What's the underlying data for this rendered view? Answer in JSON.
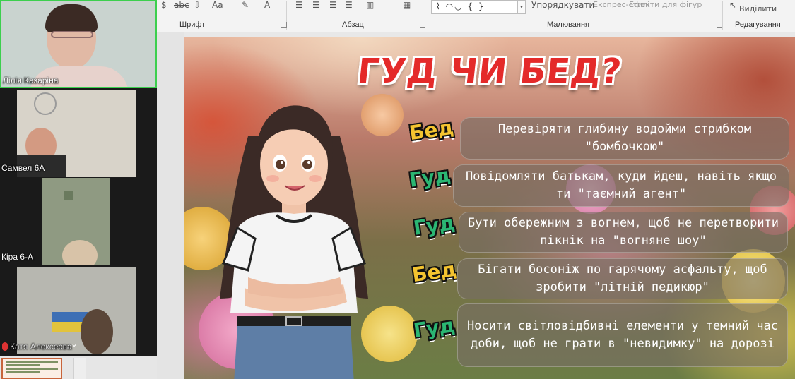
{
  "ribbon": {
    "font_group_label": "Шрифт",
    "paragraph_group_label": "Абзац",
    "drawing_group_label": "Малювання",
    "editing_group_label": "Редагування",
    "arrange_label": "Упорядкувати",
    "quick_styles_label": "Експрес-стилі",
    "shape_effects_label": "Ефекти для фігур",
    "select_label": "Виділити",
    "font_aa_label": "Aa",
    "strike_label": "abc",
    "shapes_gallery_label": "⌇ ◠◡ { }"
  },
  "participants": [
    {
      "name": "Лілія Казаріна",
      "active": true
    },
    {
      "name": "Самвел 6А",
      "active": false
    },
    {
      "name": "Кіра 6-А",
      "active": false
    },
    {
      "name": "Катя Алексеєва",
      "active": false
    }
  ],
  "slide": {
    "title": "ГУД ЧИ БЕД?",
    "statements": [
      {
        "tag": "Бед",
        "tag_color": "#f4c430",
        "text": "Перевіряти глибину водойми стрибком \"бомбочкою\""
      },
      {
        "tag": "Гуд",
        "tag_color": "#2bb673",
        "text": "Повідомляти батькам, куди йдеш, навіть якщо ти \"таємний агент\""
      },
      {
        "tag": "Гуд",
        "tag_color": "#2bb673",
        "text": "Бути обережним з вогнем, щоб не перетворити пікнік на \"вогняне шоу\""
      },
      {
        "tag": "Бед",
        "tag_color": "#f4c430",
        "text": "Бігати босоніж по гарячому асфальту, щоб зробити \"літній педикюр\""
      },
      {
        "tag": "Гуд",
        "tag_color": "#2bb673",
        "text": "Носити світловідбивні елементи у темний час доби, щоб не грати в \"невидимку\" на дорозі"
      }
    ]
  },
  "colors": {
    "title_red": "#e42a2a",
    "good_green": "#2bb673",
    "bad_yellow": "#f4c430",
    "active_speaker_border": "#3ccf4e"
  }
}
